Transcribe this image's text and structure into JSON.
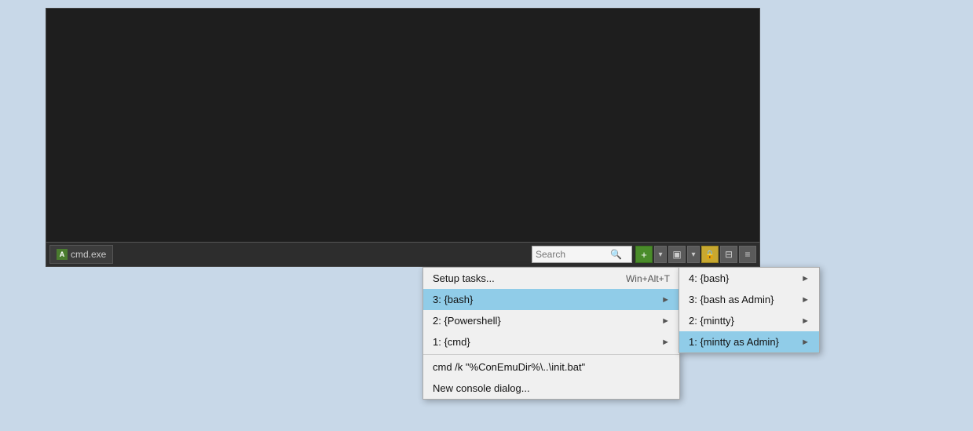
{
  "terminal": {
    "background": "#1e1e1e"
  },
  "taskbar": {
    "tab_label": "cmd.exe",
    "tab_icon": "A",
    "search_placeholder": "Search",
    "add_button": "+",
    "dropdown_arrow": "▾",
    "split_h_icon": "▣",
    "lock_icon": "🔒",
    "split_v_icon": "⊟",
    "menu_icon": "≡"
  },
  "main_menu": {
    "items": [
      {
        "label": "Setup tasks...",
        "shortcut": "Win+Alt+T",
        "has_arrow": false,
        "highlighted": false
      },
      {
        "label": "3: {bash}",
        "shortcut": "",
        "has_arrow": true,
        "highlighted": true
      },
      {
        "label": "2: {Powershell}",
        "shortcut": "",
        "has_arrow": true,
        "highlighted": false
      },
      {
        "label": "1: {cmd}",
        "shortcut": "",
        "has_arrow": true,
        "highlighted": false
      },
      {
        "label": "cmd /k \"%ConEmuDir%\\..\\init.bat\"",
        "shortcut": "",
        "has_arrow": false,
        "highlighted": false
      },
      {
        "label": "New console dialog...",
        "shortcut": "",
        "has_arrow": false,
        "highlighted": false
      }
    ]
  },
  "sub_menu": {
    "items": [
      {
        "label": "4: {bash}",
        "has_arrow": true,
        "highlighted": false
      },
      {
        "label": "3: {bash as Admin}",
        "has_arrow": true,
        "highlighted": false
      },
      {
        "label": "2: {mintty}",
        "has_arrow": true,
        "highlighted": false
      },
      {
        "label": "1: {mintty as Admin}",
        "has_arrow": true,
        "highlighted": true
      }
    ]
  }
}
